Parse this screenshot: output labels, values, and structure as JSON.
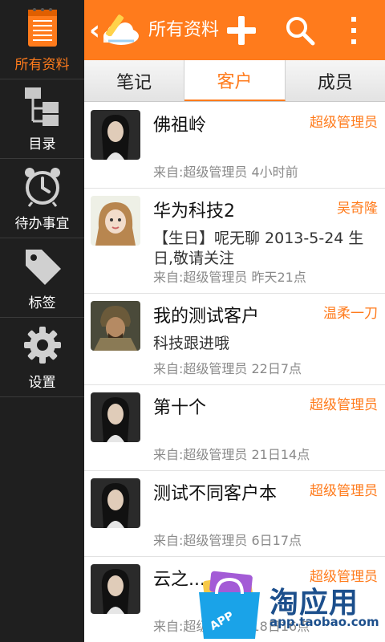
{
  "sidebar": {
    "items": [
      {
        "label": "所有资料",
        "icon": "notebook-icon",
        "active": true
      },
      {
        "label": "目录",
        "icon": "tree-folder-icon",
        "active": false
      },
      {
        "label": "待办事宜",
        "icon": "alarm-clock-icon",
        "active": false
      },
      {
        "label": "标签",
        "icon": "tag-icon",
        "active": false
      },
      {
        "label": "设置",
        "icon": "gear-icon",
        "active": false
      }
    ]
  },
  "header": {
    "title": "所有资料",
    "add_icon": "plus-icon",
    "search_icon": "search-icon",
    "menu_icon": "overflow-menu-icon"
  },
  "tabs": [
    {
      "label": "笔记",
      "active": false
    },
    {
      "label": "客户",
      "active": true
    },
    {
      "label": "成员",
      "active": false
    }
  ],
  "list": [
    {
      "title": "佛祖岭",
      "owner": "超级管理员",
      "body": "",
      "meta": "来自:超级管理员 4小时前",
      "avatar": "woman-dark"
    },
    {
      "title": "华为科技2",
      "owner": "吴奇隆",
      "body": "【生日】呢无聊 2013-5-24 生日,敬请关注",
      "meta": "来自:超级管理员 昨天21点",
      "avatar": "girl-light"
    },
    {
      "title": "我的测试客户",
      "owner": "温柔一刀",
      "body": "科技跟进哦",
      "meta": "来自:超级管理员 22日7点",
      "avatar": "warrior"
    },
    {
      "title": "第十个",
      "owner": "超级管理员",
      "body": "",
      "meta": "来自:超级管理员 21日14点",
      "avatar": "woman-dark"
    },
    {
      "title": "测试不同客户本",
      "owner": "超级管理员",
      "body": "",
      "meta": "来自:超级管理员 6日17点",
      "avatar": "woman-dark"
    },
    {
      "title": "云之...",
      "owner": "超级管理员",
      "body": "",
      "meta": "来自:超级管理员 18日16点",
      "avatar": "woman-dark"
    }
  ],
  "watermark": {
    "text": "淘应用",
    "url": "app.taobao.com",
    "bag_label": "APP"
  },
  "colors": {
    "accent": "#ff7b1c",
    "sidebar_bg": "#1f1f1f",
    "watermark_blue": "#1c4f8c"
  }
}
